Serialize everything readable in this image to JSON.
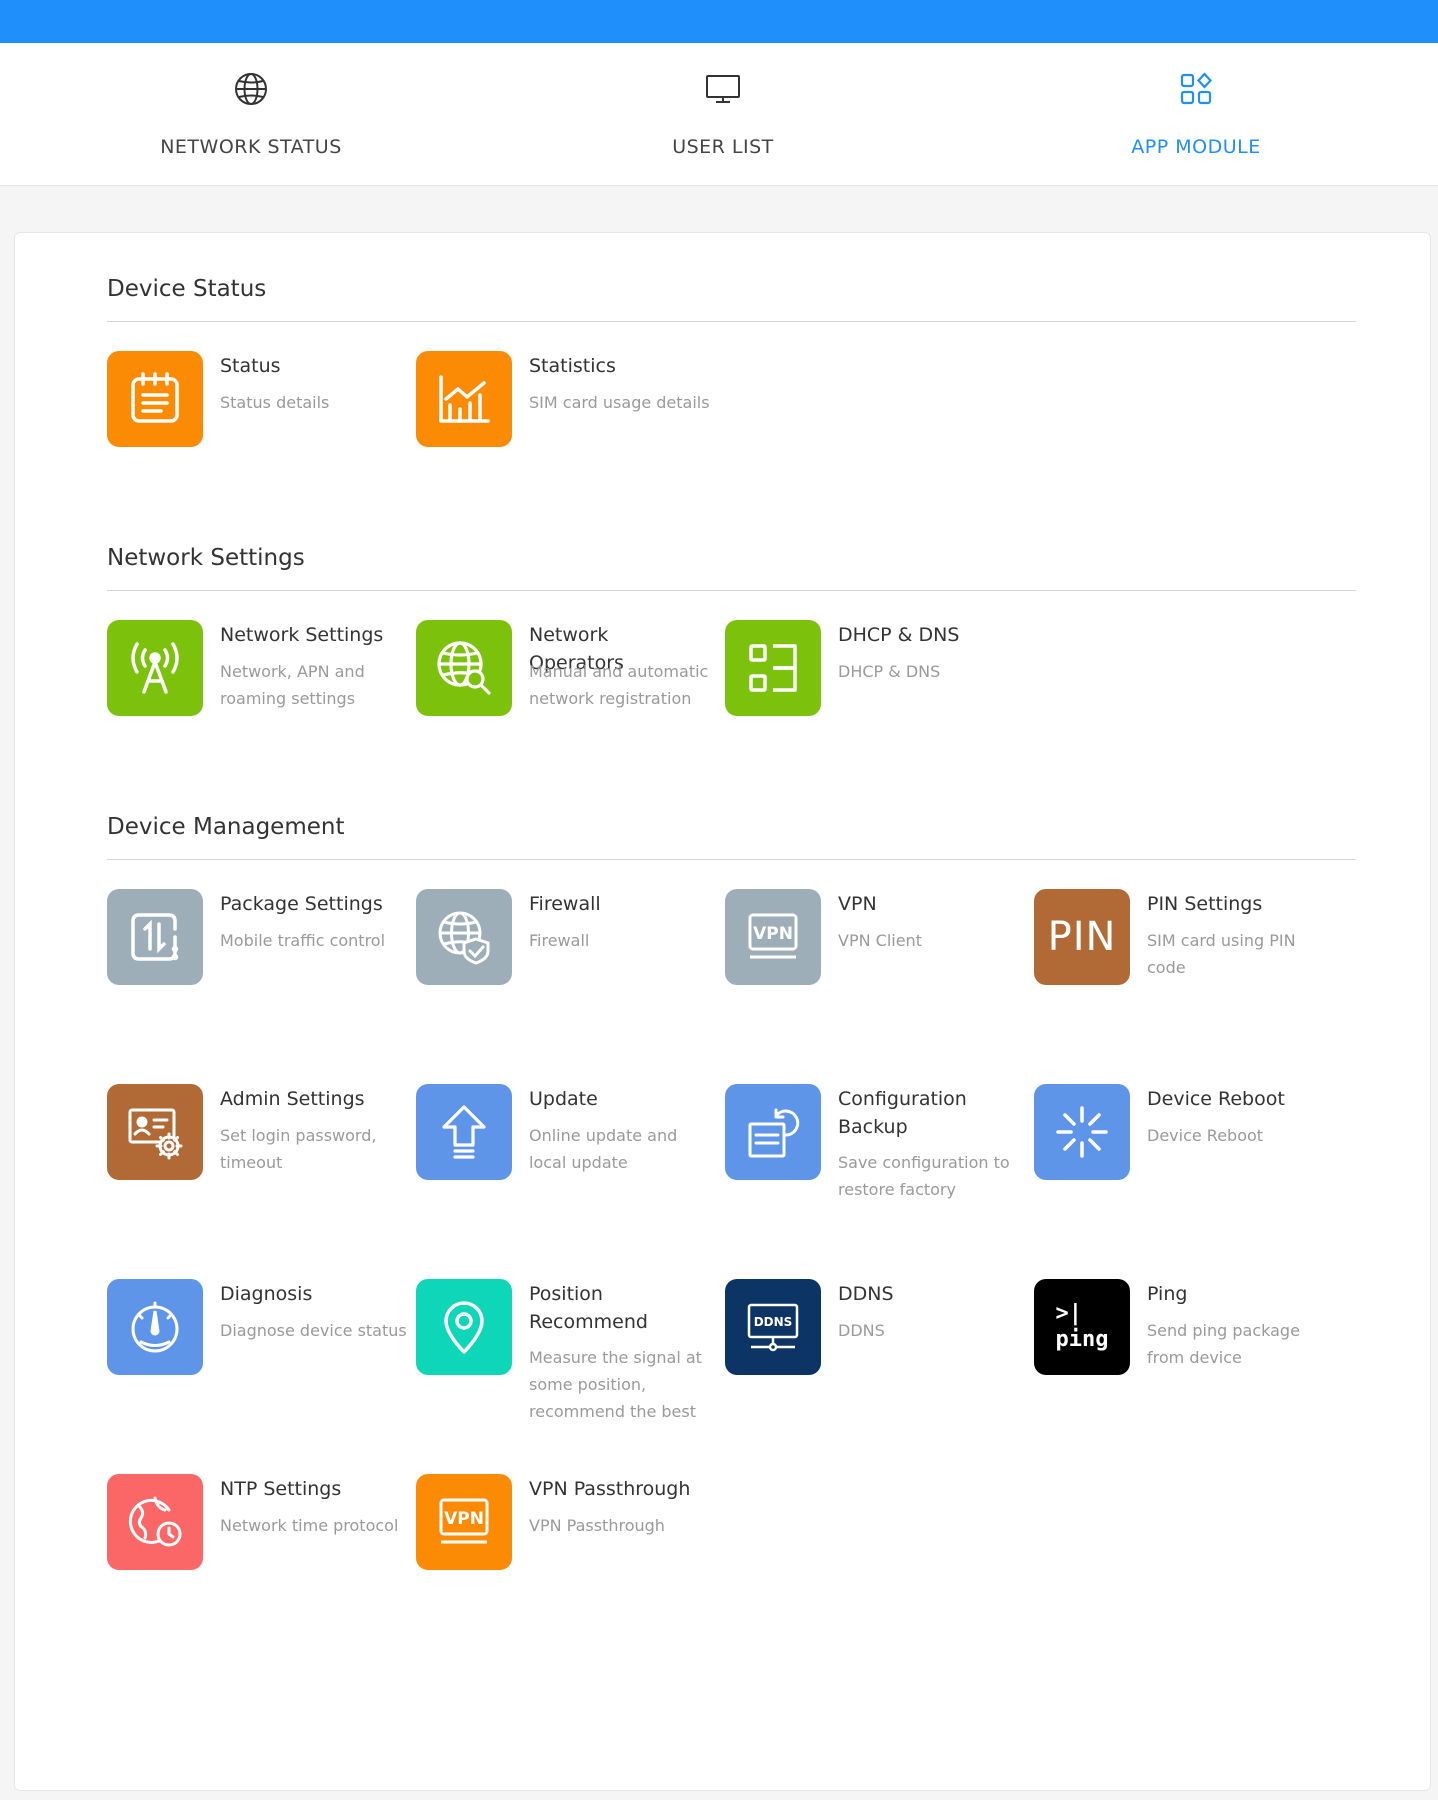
{
  "colors": {
    "accent": "#1f8ffb",
    "tab_text": "#444444",
    "desc_text": "#9a9a9a"
  },
  "tabs": [
    {
      "label": "NETWORK STATUS",
      "icon": "globe-icon"
    },
    {
      "label": "USER LIST",
      "icon": "monitor-icon"
    },
    {
      "label": "APP MODULE",
      "icon": "apps-grid-icon",
      "active": true
    }
  ],
  "sections": [
    {
      "title": "Device Status",
      "apps": [
        {
          "title": "Status",
          "desc": "Status details",
          "icon": "clipboard-icon",
          "color": "#fb8b05"
        },
        {
          "title": "Statistics",
          "desc": "SIM card usage details",
          "icon": "chart-icon",
          "color": "#fb8b05"
        }
      ]
    },
    {
      "title": "Network Settings",
      "apps": [
        {
          "title": "Network Settings",
          "desc": "Network, APN and roaming settings",
          "icon": "antenna-icon",
          "color": "#7cc20c"
        },
        {
          "title": "Network Operators",
          "desc": "Manual and automatic network registration",
          "icon": "globe-search-icon",
          "color": "#7cc20c"
        },
        {
          "title": "DHCP & DNS",
          "desc": "DHCP & DNS",
          "icon": "dhcp-icon",
          "color": "#7cc20c"
        }
      ]
    },
    {
      "title": "Device Management",
      "apps": [
        {
          "title": "Package Settings",
          "desc": "Mobile traffic control",
          "icon": "traffic-icon",
          "color": "#9eaeb9"
        },
        {
          "title": "Firewall",
          "desc": "Firewall",
          "icon": "firewall-icon",
          "color": "#9eaeb9"
        },
        {
          "title": "VPN",
          "desc": "VPN Client",
          "icon": "vpn-icon",
          "color": "#9eaeb9",
          "icon_text": "VPN"
        },
        {
          "title": "PIN Settings",
          "desc": "SIM card using PIN code",
          "icon": "pin-icon",
          "color": "#b16a36",
          "icon_text": "PIN"
        },
        {
          "title": "Admin Settings",
          "desc": "Set login password, timeout",
          "icon": "admin-icon",
          "color": "#b16a36"
        },
        {
          "title": "Update",
          "desc": "Online update and local update",
          "icon": "upload-icon",
          "color": "#5f95e8"
        },
        {
          "title": "Configuration Backup",
          "desc": "Save configuration to restore factory",
          "icon": "backup-icon",
          "color": "#5f95e8"
        },
        {
          "title": "Device Reboot",
          "desc": "Device Reboot",
          "icon": "reboot-icon",
          "color": "#5f95e8"
        },
        {
          "title": "Diagnosis",
          "desc": "Diagnose device status",
          "icon": "gauge-icon",
          "color": "#5f95e8"
        },
        {
          "title": "Position Recommend",
          "desc": "Measure the signal at some position, recommend the best",
          "icon": "location-icon",
          "color": "#0ed6b8"
        },
        {
          "title": "DDNS",
          "desc": "DDNS",
          "icon": "ddns-icon",
          "color": "#0c3566",
          "icon_text": "DDNS"
        },
        {
          "title": "Ping",
          "desc": "Send ping package from device",
          "icon": "ping-icon",
          "color": "#000000",
          "icon_text": ">|\nping"
        },
        {
          "title": "NTP Settings",
          "desc": "Network time protocol",
          "icon": "ntp-icon",
          "color": "#fb6667"
        },
        {
          "title": "VPN Passthrough",
          "desc": "VPN Passthrough",
          "icon": "vpn-passthrough-icon",
          "color": "#fb8b05",
          "icon_text": "VPN"
        }
      ]
    }
  ]
}
